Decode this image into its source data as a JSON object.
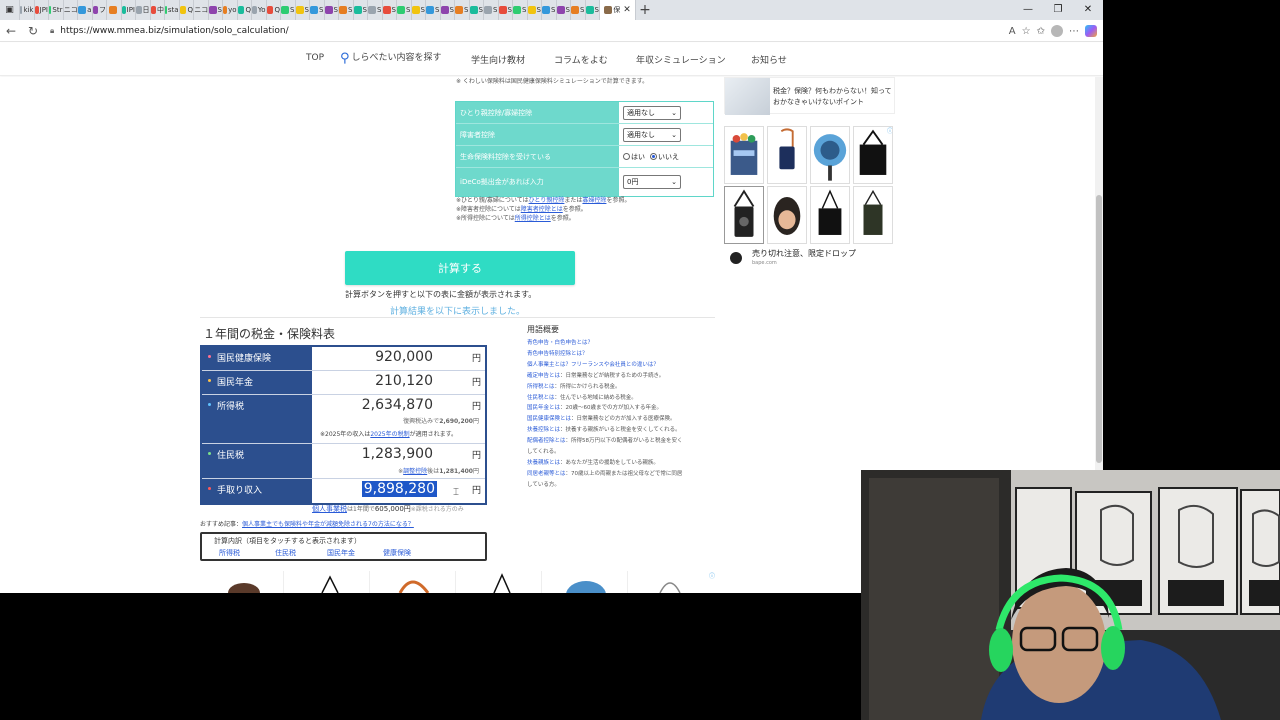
{
  "browser": {
    "tabs": [
      "kik",
      "JPI",
      "Str",
      "ニコ",
      "a",
      "フ",
      "",
      "IPI",
      "日",
      "中",
      "sta",
      "Q",
      "ニコ",
      "S",
      "yo",
      "Q",
      "Yo",
      "Q",
      "S",
      "S",
      "S",
      "S",
      "S",
      "S",
      "S",
      "S",
      "S",
      "S",
      "S",
      "S",
      "S",
      "S",
      "S",
      "S",
      "S",
      "S",
      "S",
      "S",
      "S",
      "S"
    ],
    "active_tab": "保",
    "url": "https://www.mmea.biz/simulation/solo_calculation/"
  },
  "site_nav": {
    "top": "TOP",
    "search": "しらべたい内容を探す",
    "students": "学生向け教材",
    "column": "コラムをよむ",
    "simulation": "年収シミュレーション",
    "news": "お知らせ"
  },
  "top_cut_note": "※ くわしい保険料は国民健康保険料シミュレーションで計算できます。",
  "deductions": {
    "rows": [
      {
        "label": "ひとり親控除/寡婦控除",
        "value": "適用なし"
      },
      {
        "label": "障害者控除",
        "value": "適用なし"
      },
      {
        "label": "生命保険料控除を受けている",
        "opt_yes": "はい",
        "opt_no": "いいえ"
      },
      {
        "label": "iDeCo拠出金があれば入力",
        "value": "0円"
      }
    ],
    "notes": [
      {
        "pre": "※ひとり親/寡婦については",
        "link1": "ひとり親控除",
        "mid": "または",
        "link2": "寡婦控除",
        "post": "を参照。"
      },
      {
        "pre": "※障害者控除については",
        "link1": "障害者控除とは",
        "mid": "",
        "link2": "",
        "post": "を参照。"
      },
      {
        "pre": "※所得控除については",
        "link1": "所得控除とは",
        "mid": "",
        "link2": "",
        "post": "を参照。"
      }
    ]
  },
  "calc": {
    "button": "計算する",
    "note": "計算ボタンを押すと以下の表に金額が表示されます。",
    "shown": "計算結果を以下に表示しました。"
  },
  "tax": {
    "title": "１年間の税金・保険料表",
    "yen": "円",
    "rows": [
      {
        "label": "国民健康保険",
        "value": "920,000",
        "dot": "#ff6f91"
      },
      {
        "label": "国民年金",
        "value": "210,120",
        "dot": "#ffc24a"
      },
      {
        "label": "所得税",
        "value": "2,634,870",
        "dot": "#5ec1ff",
        "sub_pre": "復興税込みで",
        "sub_val": "2,690,200",
        "sub_post": "円",
        "note_pre": "※2025年の収入は",
        "note_link": "2025年の税制",
        "note_post": "が適用されます。"
      },
      {
        "label": "住民税",
        "value": "1,283,900",
        "dot": "#7be08a",
        "sub_pre": "※",
        "sub_link": "調整控除",
        "sub_mid": "後は",
        "sub_val": "1,281,400",
        "sub_post": "円"
      },
      {
        "label": "手取り収入",
        "value": "9,898,280",
        "dot": "#ff5a5a"
      }
    ]
  },
  "kojin": {
    "link": "個人事業税",
    "text": "は1年間で",
    "value": "605,000円",
    "post": "※課税される方のみ"
  },
  "osusume": {
    "pre": "おすすめ記事：",
    "link": "個人事業主でも保険料や年金が減額免除される7の方法になる？"
  },
  "breakdown": {
    "title": "計算内訳（項目をタッチすると表示されます）",
    "links": [
      "所得税",
      "住民税",
      "国民年金",
      "健康保険"
    ]
  },
  "glossary": {
    "title": "用語概要",
    "items": [
      {
        "k": "青色申告・白色申告とは？",
        "d": ""
      },
      {
        "k": "青色申告特別控除とは？",
        "d": ""
      },
      {
        "k": "個人事業主とは？フリーランスや会社員との違いは？",
        "d": ""
      },
      {
        "k": "確定申告とは",
        "d": "：日常業務などが納税するための手続き。"
      },
      {
        "k": "所得税とは",
        "d": "：所得にかけられる税金。"
      },
      {
        "k": "住民税とは",
        "d": "：住んでいる地域に納める税金。"
      },
      {
        "k": "国民年金とは",
        "d": "：20歳〜60歳までの方が加入する年金。"
      },
      {
        "k": "国民健康保険とは",
        "d": "：日常業務などの方が加入する医療保険。"
      },
      {
        "k": "扶養控除とは",
        "d": "：扶養する親族がいると税金を安くしてくれる。"
      },
      {
        "k": "配偶者控除とは",
        "d": "：所得58万円以下の配偶者がいると税金を安く"
      },
      {
        "k": "",
        "d": "してくれる。"
      },
      {
        "k": "扶養親族とは",
        "d": "：あなたが生活の援助をしている親族。"
      },
      {
        "k": "同居老親等とは",
        "d": "：70歳以上の両親または祖父母などで常に同居"
      },
      {
        "k": "",
        "d": "している方。"
      }
    ]
  },
  "sidebar_ad": {
    "line1": "税金？保険？何もわからない！知って",
    "line2": "おかなきゃいけないポイント"
  },
  "shop_ad": {
    "caption": "売り切れ注意、限定ドロップ",
    "domain": "bape.com"
  },
  "colors": {
    "teal": "#2fdcc4",
    "navy": "#2c4f8e",
    "link": "#2a5bd7",
    "highlight": "#1e57c8"
  }
}
